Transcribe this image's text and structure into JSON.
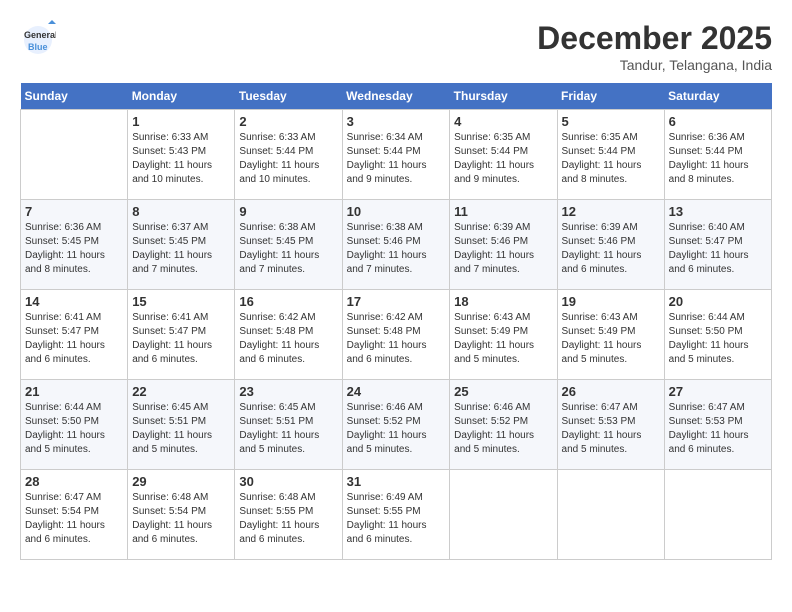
{
  "header": {
    "logo_line1": "General",
    "logo_line2": "Blue",
    "month": "December 2025",
    "location": "Tandur, Telangana, India"
  },
  "days_of_week": [
    "Sunday",
    "Monday",
    "Tuesday",
    "Wednesday",
    "Thursday",
    "Friday",
    "Saturday"
  ],
  "weeks": [
    [
      {
        "day": "",
        "info": ""
      },
      {
        "day": "1",
        "info": "Sunrise: 6:33 AM\nSunset: 5:43 PM\nDaylight: 11 hours\nand 10 minutes."
      },
      {
        "day": "2",
        "info": "Sunrise: 6:33 AM\nSunset: 5:44 PM\nDaylight: 11 hours\nand 10 minutes."
      },
      {
        "day": "3",
        "info": "Sunrise: 6:34 AM\nSunset: 5:44 PM\nDaylight: 11 hours\nand 9 minutes."
      },
      {
        "day": "4",
        "info": "Sunrise: 6:35 AM\nSunset: 5:44 PM\nDaylight: 11 hours\nand 9 minutes."
      },
      {
        "day": "5",
        "info": "Sunrise: 6:35 AM\nSunset: 5:44 PM\nDaylight: 11 hours\nand 8 minutes."
      },
      {
        "day": "6",
        "info": "Sunrise: 6:36 AM\nSunset: 5:44 PM\nDaylight: 11 hours\nand 8 minutes."
      }
    ],
    [
      {
        "day": "7",
        "info": "Sunrise: 6:36 AM\nSunset: 5:45 PM\nDaylight: 11 hours\nand 8 minutes."
      },
      {
        "day": "8",
        "info": "Sunrise: 6:37 AM\nSunset: 5:45 PM\nDaylight: 11 hours\nand 7 minutes."
      },
      {
        "day": "9",
        "info": "Sunrise: 6:38 AM\nSunset: 5:45 PM\nDaylight: 11 hours\nand 7 minutes."
      },
      {
        "day": "10",
        "info": "Sunrise: 6:38 AM\nSunset: 5:46 PM\nDaylight: 11 hours\nand 7 minutes."
      },
      {
        "day": "11",
        "info": "Sunrise: 6:39 AM\nSunset: 5:46 PM\nDaylight: 11 hours\nand 7 minutes."
      },
      {
        "day": "12",
        "info": "Sunrise: 6:39 AM\nSunset: 5:46 PM\nDaylight: 11 hours\nand 6 minutes."
      },
      {
        "day": "13",
        "info": "Sunrise: 6:40 AM\nSunset: 5:47 PM\nDaylight: 11 hours\nand 6 minutes."
      }
    ],
    [
      {
        "day": "14",
        "info": "Sunrise: 6:41 AM\nSunset: 5:47 PM\nDaylight: 11 hours\nand 6 minutes."
      },
      {
        "day": "15",
        "info": "Sunrise: 6:41 AM\nSunset: 5:47 PM\nDaylight: 11 hours\nand 6 minutes."
      },
      {
        "day": "16",
        "info": "Sunrise: 6:42 AM\nSunset: 5:48 PM\nDaylight: 11 hours\nand 6 minutes."
      },
      {
        "day": "17",
        "info": "Sunrise: 6:42 AM\nSunset: 5:48 PM\nDaylight: 11 hours\nand 6 minutes."
      },
      {
        "day": "18",
        "info": "Sunrise: 6:43 AM\nSunset: 5:49 PM\nDaylight: 11 hours\nand 5 minutes."
      },
      {
        "day": "19",
        "info": "Sunrise: 6:43 AM\nSunset: 5:49 PM\nDaylight: 11 hours\nand 5 minutes."
      },
      {
        "day": "20",
        "info": "Sunrise: 6:44 AM\nSunset: 5:50 PM\nDaylight: 11 hours\nand 5 minutes."
      }
    ],
    [
      {
        "day": "21",
        "info": "Sunrise: 6:44 AM\nSunset: 5:50 PM\nDaylight: 11 hours\nand 5 minutes."
      },
      {
        "day": "22",
        "info": "Sunrise: 6:45 AM\nSunset: 5:51 PM\nDaylight: 11 hours\nand 5 minutes."
      },
      {
        "day": "23",
        "info": "Sunrise: 6:45 AM\nSunset: 5:51 PM\nDaylight: 11 hours\nand 5 minutes."
      },
      {
        "day": "24",
        "info": "Sunrise: 6:46 AM\nSunset: 5:52 PM\nDaylight: 11 hours\nand 5 minutes."
      },
      {
        "day": "25",
        "info": "Sunrise: 6:46 AM\nSunset: 5:52 PM\nDaylight: 11 hours\nand 5 minutes."
      },
      {
        "day": "26",
        "info": "Sunrise: 6:47 AM\nSunset: 5:53 PM\nDaylight: 11 hours\nand 5 minutes."
      },
      {
        "day": "27",
        "info": "Sunrise: 6:47 AM\nSunset: 5:53 PM\nDaylight: 11 hours\nand 6 minutes."
      }
    ],
    [
      {
        "day": "28",
        "info": "Sunrise: 6:47 AM\nSunset: 5:54 PM\nDaylight: 11 hours\nand 6 minutes."
      },
      {
        "day": "29",
        "info": "Sunrise: 6:48 AM\nSunset: 5:54 PM\nDaylight: 11 hours\nand 6 minutes."
      },
      {
        "day": "30",
        "info": "Sunrise: 6:48 AM\nSunset: 5:55 PM\nDaylight: 11 hours\nand 6 minutes."
      },
      {
        "day": "31",
        "info": "Sunrise: 6:49 AM\nSunset: 5:55 PM\nDaylight: 11 hours\nand 6 minutes."
      },
      {
        "day": "",
        "info": ""
      },
      {
        "day": "",
        "info": ""
      },
      {
        "day": "",
        "info": ""
      }
    ]
  ]
}
